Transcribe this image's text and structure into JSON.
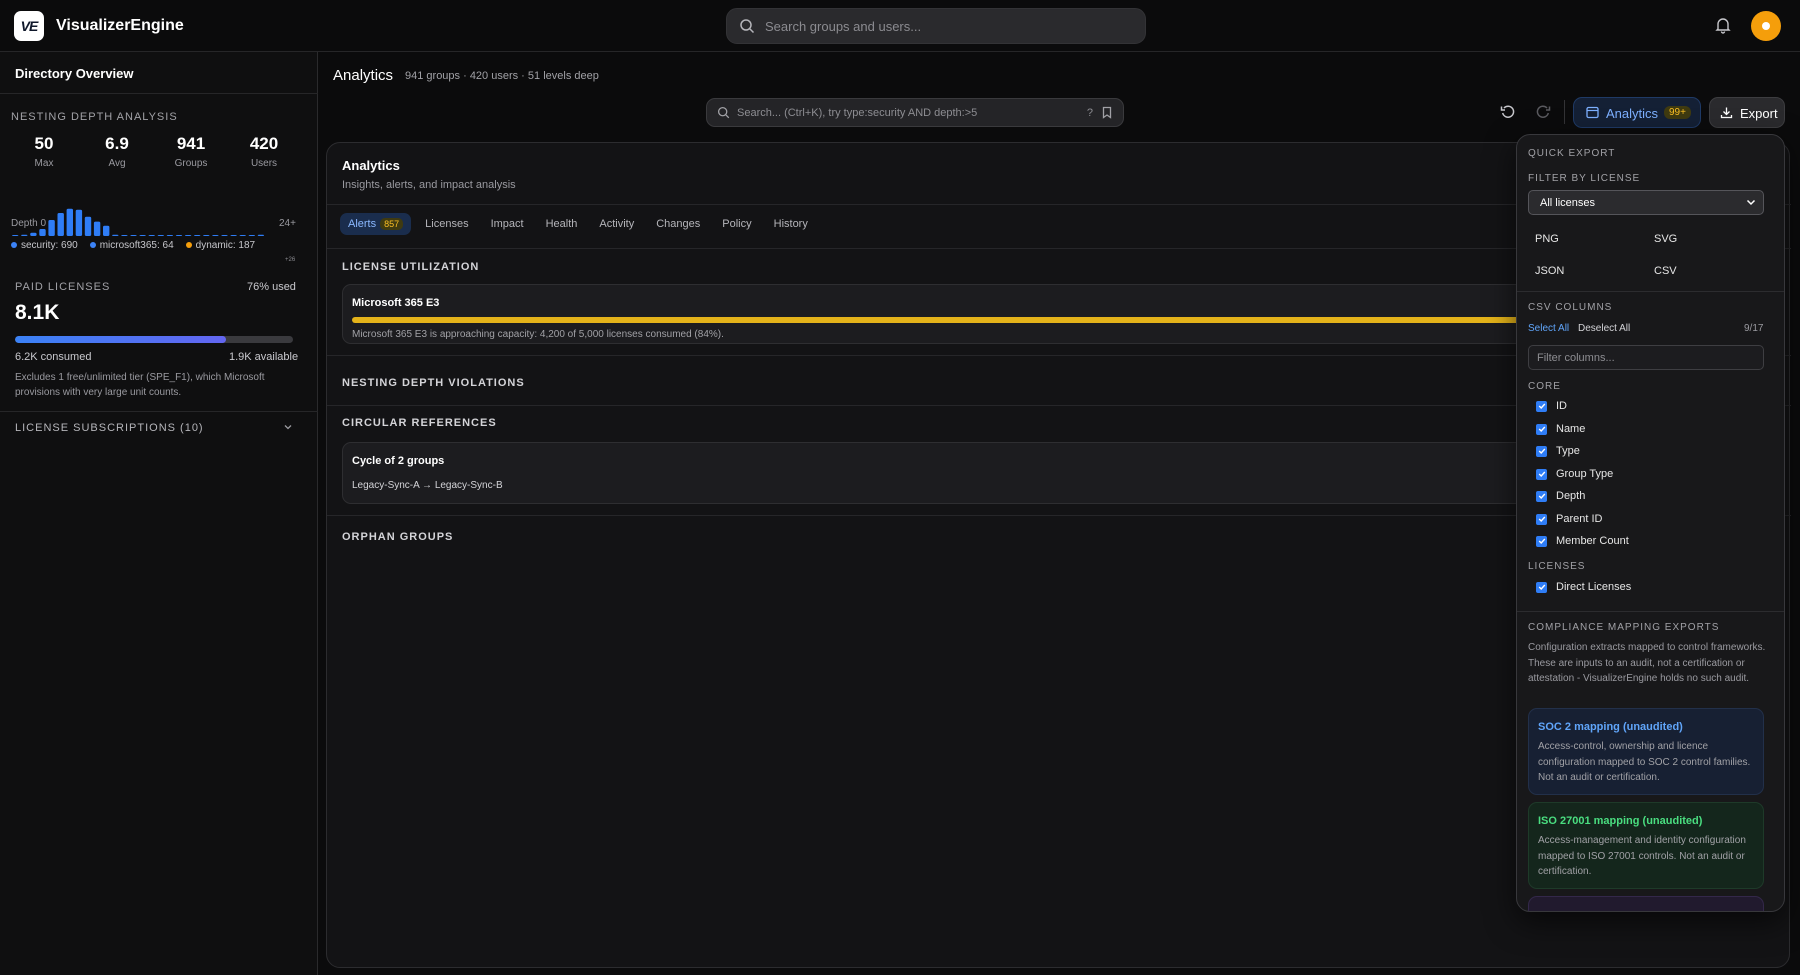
{
  "app": {
    "name": "VisualizerEngine",
    "logo_text": "VE"
  },
  "topbar": {
    "search_placeholder": "Search groups and users..."
  },
  "sidebar": {
    "title": "Directory Overview",
    "nesting": {
      "label": "NESTING DEPTH ANALYSIS",
      "stats": [
        {
          "value": "50",
          "label": "Max"
        },
        {
          "value": "6.9",
          "label": "Avg"
        },
        {
          "value": "941",
          "label": "Groups"
        },
        {
          "value": "420",
          "label": "Users"
        }
      ],
      "histogram": [
        0.02,
        0.04,
        0.1,
        0.22,
        0.5,
        0.72,
        0.85,
        0.82,
        0.6,
        0.45,
        0.32,
        0.04,
        0.02,
        0.03,
        0.02,
        0.03,
        0.02,
        0.02,
        0.02,
        0.02,
        0.02,
        0.02,
        0.02,
        0.02,
        0.02,
        0.02,
        0.02,
        0.04
      ],
      "overflow_label": "+26",
      "axis_start": "Depth 0",
      "axis_end": "24+",
      "legend": [
        {
          "label": "security: 690",
          "color": "#3b82f6"
        },
        {
          "label": "microsoft365: 64",
          "color": "#3b82f6"
        },
        {
          "label": "dynamic: 187",
          "color": "#f59e0b"
        }
      ]
    },
    "licenses": {
      "label": "PAID LICENSES",
      "used": "76% used",
      "total": "8.1K",
      "used_fraction": 0.76,
      "consumed": "6.2K consumed",
      "available": "1.9K available",
      "note": "Excludes 1 free/unlimited tier (SPE_F1), which Microsoft provisions with very large unit counts."
    },
    "subscriptions_label": "LICENSE SUBSCRIPTIONS (10)"
  },
  "main": {
    "title": "Analytics",
    "subtitle": "941 groups · 420 users · 51 levels deep",
    "query_placeholder": "Search... (Ctrl+K), try type:security AND depth:>5",
    "query_help": "?",
    "analytics_button": "Analytics",
    "analytics_badge": "99+",
    "export_button": "Export"
  },
  "panel": {
    "title": "Analytics",
    "subtitle": "Insights, alerts, and impact analysis",
    "tabs": [
      {
        "label": "Alerts",
        "badge": "857"
      },
      {
        "label": "Licenses"
      },
      {
        "label": "Impact"
      },
      {
        "label": "Health"
      },
      {
        "label": "Activity"
      },
      {
        "label": "Changes"
      },
      {
        "label": "Policy"
      },
      {
        "label": "History"
      }
    ],
    "license_utilization": {
      "heading": "LICENSE UTILIZATION",
      "card_title": "Microsoft 365 E3",
      "card_desc": "Microsoft 365 E3 is approaching capacity: 4,200 of 5,000 licenses consumed (84%)."
    },
    "nesting_violations_heading": "NESTING DEPTH VIOLATIONS",
    "circular": {
      "heading": "CIRCULAR REFERENCES",
      "card_title": "Cycle of 2 groups",
      "card_path": "Legacy-Sync-A → Legacy-Sync-B"
    },
    "orphans_heading": "ORPHAN GROUPS"
  },
  "export_menu": {
    "quick_export": "QUICK EXPORT",
    "filter_label": "FILTER BY LICENSE",
    "filter_value": "All licenses",
    "formats": [
      "PNG",
      "SVG",
      "JSON",
      "CSV"
    ],
    "csv_columns_label": "CSV COLUMNS",
    "select_all": "Select All",
    "deselect_all": "Deselect All",
    "column_count": "9/17",
    "filter_placeholder": "Filter columns...",
    "core_label": "CORE",
    "core_columns": [
      "ID",
      "Name",
      "Type",
      "Group Type",
      "Depth",
      "Parent ID",
      "Member Count"
    ],
    "licenses_label": "LICENSES",
    "license_columns": [
      "Direct Licenses"
    ],
    "compliance_label": "COMPLIANCE MAPPING EXPORTS",
    "compliance_desc": "Configuration extracts mapped to control frameworks. These are inputs to an audit, not a certification or attestation - VisualizerEngine holds no such audit.",
    "mappings": [
      {
        "title": "SOC 2 mapping (unaudited)",
        "desc": "Access-control, ownership and licence configuration mapped to SOC 2 control families. Not an audit or certification.",
        "color": "#60a5fa"
      },
      {
        "title": "ISO 27001 mapping (unaudited)",
        "desc": "Access-management and identity configuration mapped to ISO 27001 controls. Not an audit or certification.",
        "color": "#4ade80"
      }
    ]
  }
}
